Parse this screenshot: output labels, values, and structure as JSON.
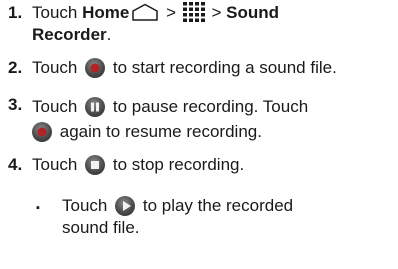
{
  "steps": [
    {
      "num": "1.",
      "touch": "Touch",
      "home": "Home",
      "sep1": ">",
      "sep2": ">",
      "app_line1": "Sound",
      "app_line2": "Recorder",
      "period": ".",
      "home_icon": "house-outline-icon",
      "all_apps_icon": "grid-dots-icon"
    },
    {
      "num": "2.",
      "touch": "Touch",
      "after": "to start recording a sound file.",
      "icon": "record-button-icon"
    },
    {
      "num": "3.",
      "touch": "Touch",
      "after": "to pause recording. Touch",
      "after2": "again to resume recording.",
      "icon": "pause-button-icon",
      "icon2": "record-button-icon"
    },
    {
      "num": "4.",
      "touch": "Touch",
      "after": "to stop recording.",
      "icon": "stop-button-icon"
    }
  ],
  "bullet": {
    "marker": "▪",
    "touch": "Touch",
    "after_line1": "to play the recorded",
    "after_line2": "sound file.",
    "icon": "play-button-icon"
  },
  "colors": {
    "button_fill": "#4a4a4a",
    "record_dot": "#b32222",
    "text": "#1a1a1a"
  }
}
